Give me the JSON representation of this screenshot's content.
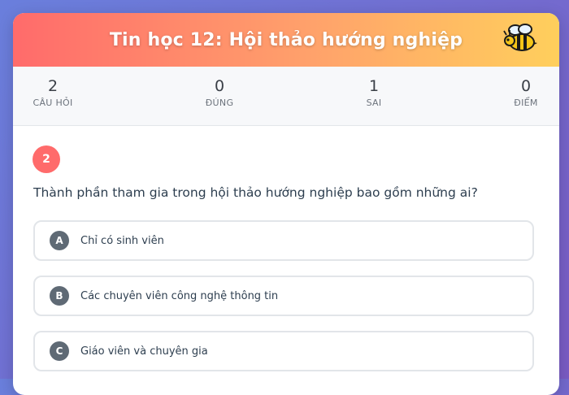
{
  "header": {
    "title": "Tin học 12: Hội thảo hướng nghiệp",
    "mascot_icon": "bee-icon"
  },
  "stats": [
    {
      "value": "2",
      "label": "CÂU HỎI"
    },
    {
      "value": "0",
      "label": "ĐÚNG"
    },
    {
      "value": "1",
      "label": "SAI"
    },
    {
      "value": "0",
      "label": "ĐIỂM"
    }
  ],
  "question": {
    "number": "2",
    "text": "Thành phần tham gia trong hội thảo hướng nghiệp bao gồm những ai?",
    "options": [
      {
        "letter": "A",
        "text": "Chỉ có sinh viên"
      },
      {
        "letter": "B",
        "text": "Các chuyên viên công nghệ thông tin"
      },
      {
        "letter": "C",
        "text": "Giáo viên và chuyên gia"
      }
    ]
  },
  "colors": {
    "accent": "#ff6b6b",
    "header_gradient_start": "#ff6b6b",
    "header_gradient_end": "#ffcf5c",
    "background": "#6a7fdc"
  }
}
